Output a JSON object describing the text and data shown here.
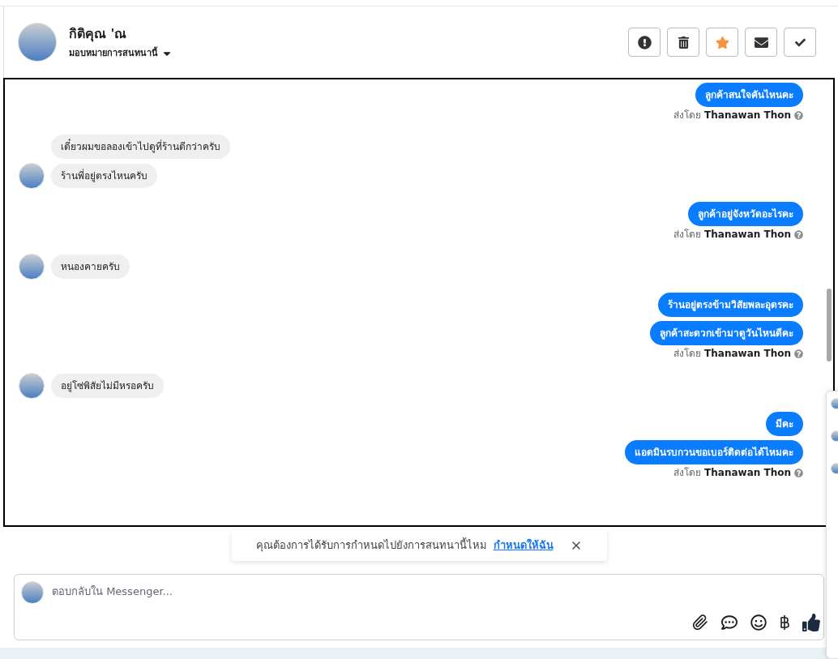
{
  "header": {
    "name": "กิติคุณ 'ณ",
    "assign_label": "มอบหมายการสนทนานี้",
    "starred": true
  },
  "messages": [
    {
      "kind": "outgoing",
      "text": "ลูกค้าสนใจคันไหนคะ"
    },
    {
      "kind": "sender",
      "prefix": "ส่งโดย",
      "name": "Thanawan Thon"
    },
    {
      "kind": "incoming",
      "text": "เดี๋ยวผมขอลองเข้าไปดูที่ร้านดีกว่าครับ",
      "avatar": false
    },
    {
      "kind": "incoming",
      "text": "ร้านพี่อยู่ตรงไหนครับ",
      "avatar": true
    },
    {
      "kind": "outgoing",
      "text": "ลูกค้าอยู่จังหวัดอะไรคะ"
    },
    {
      "kind": "sender",
      "prefix": "ส่งโดย",
      "name": "Thanawan Thon"
    },
    {
      "kind": "incoming",
      "text": "หนองคายครับ",
      "avatar": true
    },
    {
      "kind": "outgoing",
      "text": "ร้านอยู่ตรงข้ามวิสัยพละอุดรคะ"
    },
    {
      "kind": "outgoing",
      "text": "ลูกค้าสะดวกเข้ามาดูวันไหนดีคะ"
    },
    {
      "kind": "sender",
      "prefix": "ส่งโดย",
      "name": "Thanawan Thon"
    },
    {
      "kind": "incoming",
      "text": "อยู่โซ่พิสัยไม่มีหรอครับ",
      "avatar": true
    },
    {
      "kind": "outgoing",
      "text": "มีคะ"
    },
    {
      "kind": "outgoing",
      "text": "แอดมินรบกวนขอเบอร์ติดต่อได้ไหมคะ"
    },
    {
      "kind": "sender",
      "prefix": "ส่งโดย",
      "name": "Thanawan Thon"
    }
  ],
  "banner": {
    "text": "คุณต้องการได้รับการกำหนดไปยังการสนทนานี้ไหม",
    "link": "กำหนดให้ฉัน"
  },
  "composer": {
    "placeholder": "ตอบกลับใน Messenger..."
  }
}
